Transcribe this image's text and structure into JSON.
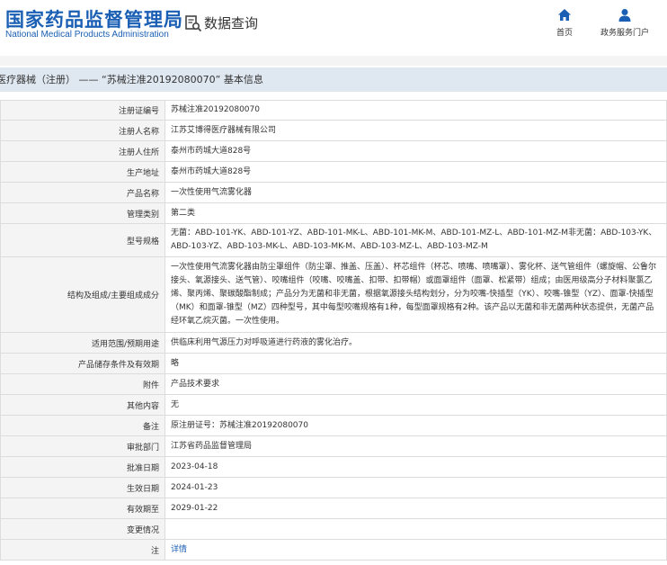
{
  "header": {
    "logo_cn": "国家药品监督管理局",
    "logo_en": "National Medical Products Administration",
    "query_label": "数据查询",
    "nav": [
      {
        "label": "首页",
        "icon": "home-icon"
      },
      {
        "label": "政务服务门户",
        "icon": "user-icon"
      }
    ]
  },
  "breadcrumb_title": "医疗器械（注册） —— “苏械注准20192080070” 基本信息",
  "rows": [
    {
      "label": "注册证编号",
      "value": "苏械注准20192080070"
    },
    {
      "label": "注册人名称",
      "value": "江苏艾博得医疗器械有限公司"
    },
    {
      "label": "注册人住所",
      "value": "泰州市药城大道828号"
    },
    {
      "label": "生产地址",
      "value": "泰州市药城大道828号"
    },
    {
      "label": "产品名称",
      "value": "一次性使用气流雾化器"
    },
    {
      "label": "管理类别",
      "value": "第二类"
    },
    {
      "label": "型号规格",
      "value": "无菌：ABD-101-YK、ABD-101-YZ、ABD-101-MK-L、ABD-101-MK-M、ABD-101-MZ-L、ABD-101-MZ-M非无菌：ABD-103-YK、ABD-103-YZ、ABD-103-MK-L、ABD-103-MK-M、ABD-103-MZ-L、ABD-103-MZ-M"
    },
    {
      "label": "结构及组成/主要组成成分",
      "value": "一次性使用气流雾化器由防尘罩组件（防尘罩、推盖、压盖）、杯芯组件（杯芯、喷嘴、喷嘴罩）、雾化杯、送气管组件（螺旋帽、公鲁尔接头、氧源接头、送气管）、咬嘴组件（咬嘴、咬嘴盖、扣带、扣带帽）或面罩组件（面罩、松紧带）组成；由医用级高分子材料聚氯乙烯、聚丙烯、聚碳酸酯制成；产品分为无菌和非无菌，根据氧源接头结构划分，分为咬嘴-快插型（YK）、咬嘴-锥型（YZ）、面罩-快插型（MK）和面罩-锥型（MZ）四种型号，其中每型咬嘴规格有1种，每型面罩规格有2种。该产品以无菌和非无菌两种状态提供，无菌产品经环氧乙烷灭菌。一次性使用。"
    },
    {
      "label": "适用范围/预期用途",
      "value": "供临床利用气源压力对呼吸道进行药液的雾化治疗。"
    },
    {
      "label": "产品储存条件及有效期",
      "value": "略"
    },
    {
      "label": "附件",
      "value": "产品技术要求"
    },
    {
      "label": "其他内容",
      "value": "无"
    },
    {
      "label": "备注",
      "value": "原注册证号：苏械注准20192080070"
    },
    {
      "label": "审批部门",
      "value": "江苏省药品监督管理局"
    },
    {
      "label": "批准日期",
      "value": "2023-04-18"
    },
    {
      "label": "生效日期",
      "value": "2024-01-23"
    },
    {
      "label": "有效期至",
      "value": "2029-01-22"
    },
    {
      "label": "变更情况",
      "value": ""
    },
    {
      "label": "注",
      "value": "详情"
    }
  ]
}
